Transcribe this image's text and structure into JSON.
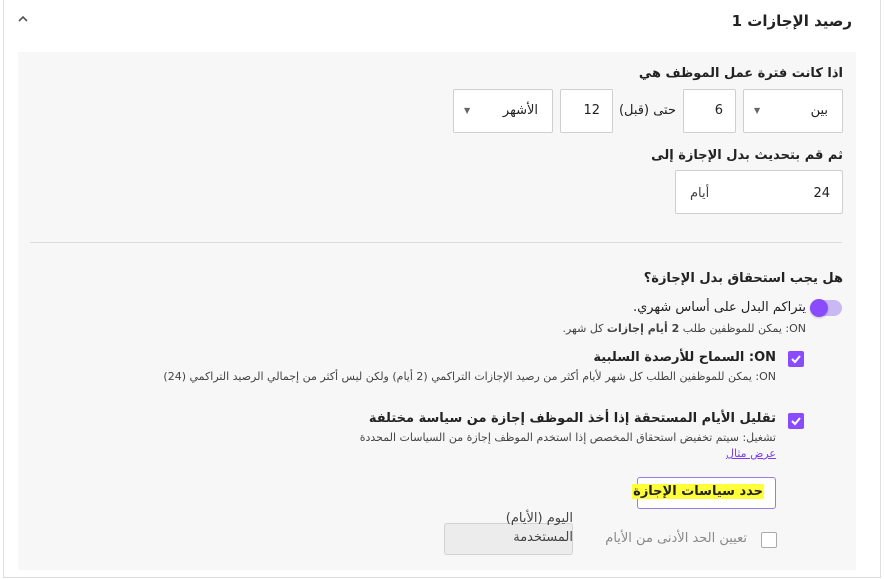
{
  "section": {
    "title": "رصيد الإجازات 1"
  },
  "period": {
    "label": "اذا كانت فترة عمل الموظف هي",
    "range_select": "بين",
    "from_value": "6",
    "separator": "حتى (قبل)",
    "to_value": "12",
    "unit_select": "الأشهر"
  },
  "update": {
    "label": "ثم قم بتحديث بدل الإجازة إلى",
    "value": "24",
    "unit": "أيام"
  },
  "accrual": {
    "question": "هل يجب استحقاق بدل الإجازة؟",
    "monthly_title": "يتراكم البدل على أساس شهري.",
    "monthly_desc_prefix": "ON: يمكن للموظفين طلب ",
    "monthly_desc_bold": "2 أيام إجازات",
    "monthly_desc_suffix": " كل شهر.",
    "negative_title": "ON: السماح للأرصدة السلبية",
    "negative_desc": "ON: يمكن للموظفين الطلب كل شهر لأيام أكثر من رصيد الإجازات التراكمي (2 أيام) ولكن ليس أكثر من إجمالي الرصيد التراكمي (24)",
    "reduce_title": "تقليل الأيام المستحقة إذا أخذ الموظف إجازة من سياسة مختلفة",
    "reduce_desc": "تشغيل: سيتم تخفيض استحقاق المخصص إذا استخدم الموظف إجازة من السياسات المحددة",
    "example_link": "عرض مثال",
    "policies_button": "حدد سياسات الإجازة",
    "min_days_label": "تعيين الحد الأدنى من الأيام",
    "min_days_unit_line1": "اليوم (الأيام)",
    "min_days_unit_line2": "المستخدمة"
  }
}
